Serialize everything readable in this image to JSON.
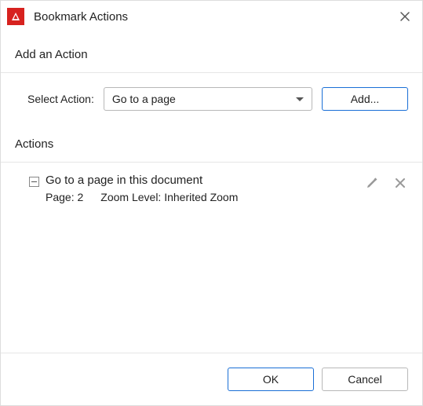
{
  "titlebar": {
    "title": "Bookmark Actions"
  },
  "add_section": {
    "heading": "Add an Action",
    "select_label": "Select Action:",
    "select_value": "Go to a page",
    "add_button": "Add..."
  },
  "actions_section": {
    "heading": "Actions",
    "items": [
      {
        "title": "Go to a page in this document",
        "page_label": "Page:",
        "page_value": "2",
        "zoom_label": "Zoom Level:",
        "zoom_value": "Inherited Zoom"
      }
    ]
  },
  "footer": {
    "ok": "OK",
    "cancel": "Cancel"
  }
}
